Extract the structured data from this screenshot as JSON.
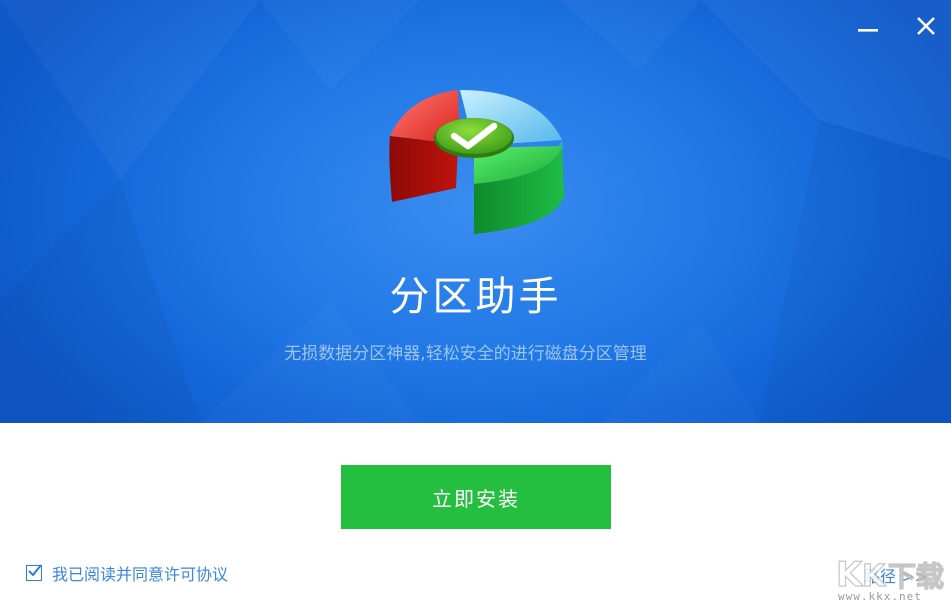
{
  "window": {
    "minimize_icon": "minimize-icon",
    "close_icon": "close-icon"
  },
  "app": {
    "title": "分区助手",
    "tagline": "无损数据分区神器,轻松安全的进行磁盘分区管理",
    "logo_icon": "partition-pie-check-icon"
  },
  "actions": {
    "install_label": "立即安装",
    "agreement_label": "我已阅读并同意许可协议",
    "agreement_checked": true,
    "path_label": "路径 >>"
  },
  "watermark": {
    "domain": "www.kkx.net"
  },
  "colors": {
    "banner": "#1b72e2",
    "install_button": "#25bf3f",
    "link": "#3a86dc"
  }
}
